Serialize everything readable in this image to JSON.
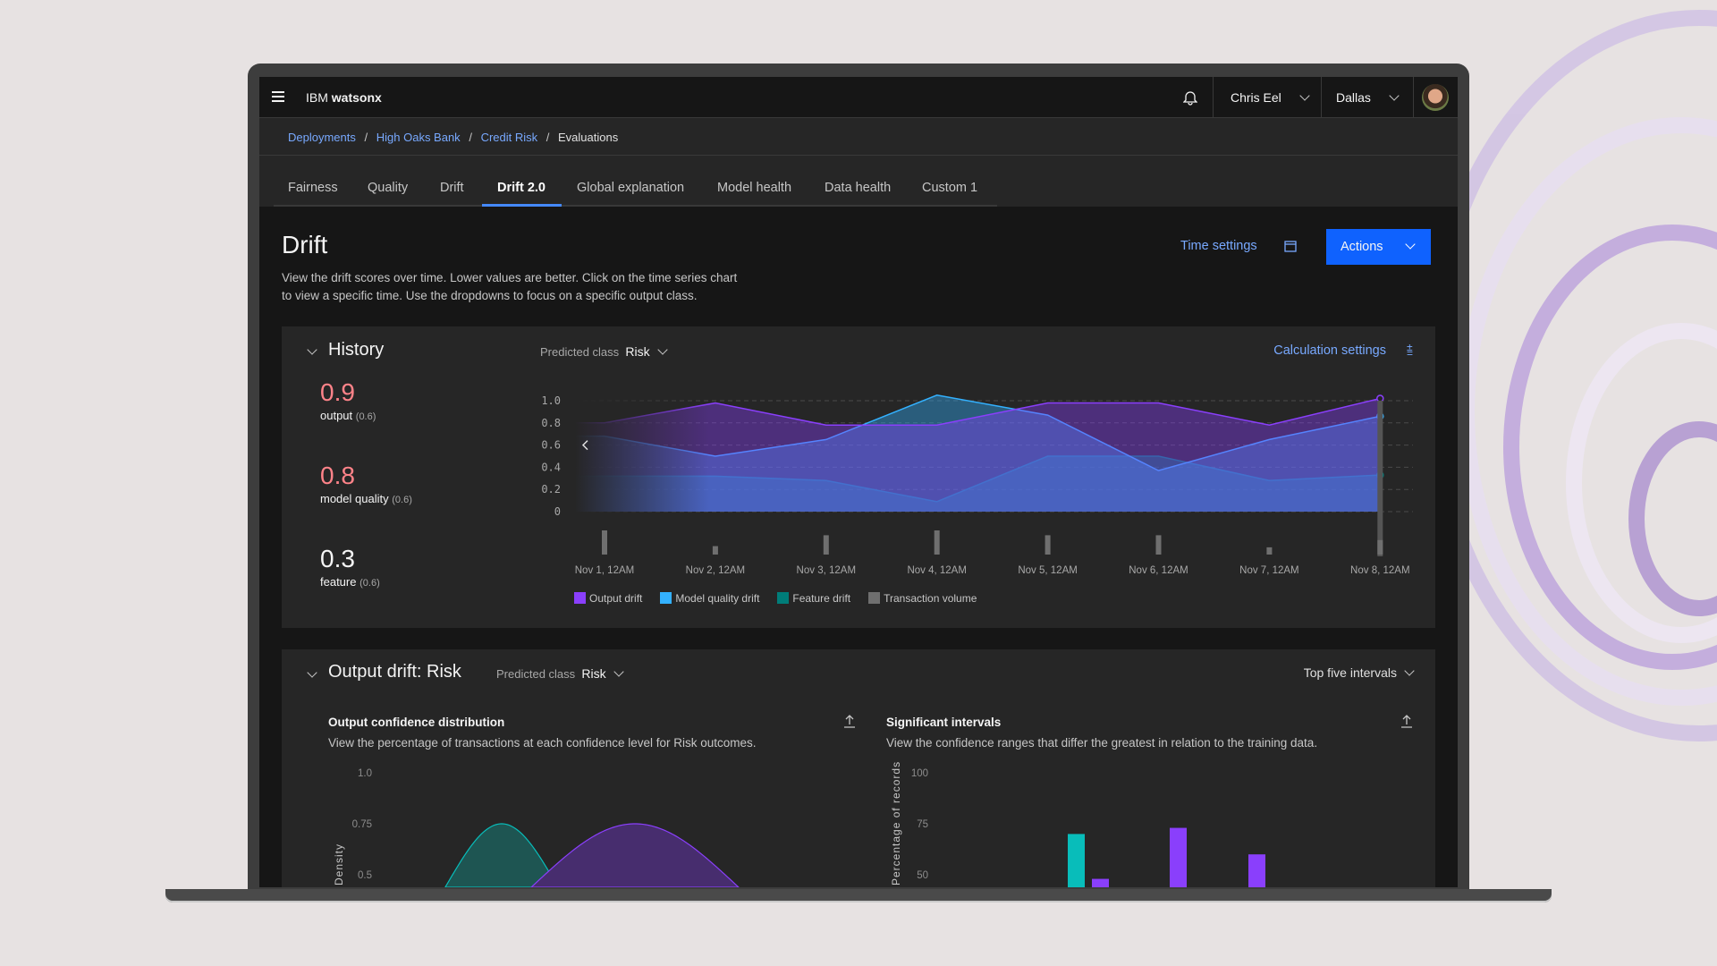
{
  "header": {
    "menu_icon": "hamburger-icon",
    "app_name_prefix": "IBM",
    "app_name": "watsonx",
    "notification_icon": "bell-icon",
    "user": "Chris Eel",
    "region": "Dallas",
    "avatar": "user-avatar"
  },
  "breadcrumb": [
    {
      "label": "Deployments"
    },
    {
      "label": "High Oaks Bank"
    },
    {
      "label": "Credit Risk"
    },
    {
      "label": "Evaluations"
    }
  ],
  "breadcrumb_sep": "/",
  "tabs": [
    {
      "label": "Fairness"
    },
    {
      "label": "Quality"
    },
    {
      "label": "Drift"
    },
    {
      "label": "Drift 2.0",
      "active": true
    },
    {
      "label": "Global explanation"
    },
    {
      "label": "Model health"
    },
    {
      "label": "Data health"
    },
    {
      "label": "Custom 1"
    }
  ],
  "page": {
    "title": "Drift",
    "description_1": "View the drift scores over time. Lower values are better. Click on the time series chart",
    "description_2": "to view a specific time. Use the dropdowns to focus on a specific output class.",
    "time_settings": "Time settings",
    "actions": "Actions",
    "accent": "#0f62fe"
  },
  "history": {
    "title": "History",
    "predicted_class_label": "Predicted class",
    "predicted_class": "Risk",
    "calc_settings": "Calculation settings",
    "scores": [
      {
        "value": "0.9",
        "label": "output",
        "threshold": "(0.6)",
        "color": "#ff8389"
      },
      {
        "value": "0.8",
        "label": "model quality",
        "threshold": "(0.6)",
        "color": "#ff8389"
      },
      {
        "value": "0.3",
        "label": "feature",
        "threshold": "(0.6)",
        "color": "#f4f4f4"
      }
    ]
  },
  "chart_data": [
    {
      "type": "area",
      "x": [
        "Nov 1, 12AM",
        "Nov 2, 12AM",
        "Nov 3, 12AM",
        "Nov 4, 12AM",
        "Nov 5, 12AM",
        "Nov 6, 12AM",
        "Nov 7, 12AM",
        "Nov 8, 12AM"
      ],
      "yticks": [
        "1.0",
        "0.8",
        "0.6",
        "0.4",
        "0.2",
        "0"
      ],
      "ylim": [
        0,
        1
      ],
      "grid": true,
      "legend": "bottom",
      "series": [
        {
          "name": "Output drift",
          "color": "#8a3ffc",
          "values": [
            0.8,
            0.98,
            0.78,
            0.78,
            0.98,
            0.98,
            0.78,
            1.02
          ]
        },
        {
          "name": "Model quality drift",
          "color": "#33b1ff",
          "values": [
            0.68,
            0.5,
            0.65,
            1.05,
            0.87,
            0.37,
            0.65,
            0.86
          ]
        },
        {
          "name": "Feature drift",
          "color": "#007d79",
          "values": [
            0.32,
            0.32,
            0.28,
            0.09,
            0.5,
            0.5,
            0.28,
            0.33
          ]
        },
        {
          "name": "Transaction volume",
          "color": "#6f6f6f",
          "values": [
            1.0,
            0.35,
            0.8,
            1.0,
            0.8,
            0.8,
            0.3,
            0.6
          ]
        }
      ]
    },
    {
      "type": "area",
      "title": "Output confidence distribution",
      "ylabel": "Density",
      "yticks": [
        "1.0",
        "0.75",
        "0.5"
      ],
      "ylim": [
        0,
        1
      ],
      "series": [
        {
          "color": "#08bdba",
          "peak": 0.75
        },
        {
          "color": "#8a3ffc",
          "peak": 0.75
        }
      ]
    },
    {
      "type": "bar",
      "title": "Significant intervals",
      "ylabel": "Percentage of records",
      "yticks": [
        "100",
        "75",
        "50"
      ],
      "ylim": [
        0,
        100
      ],
      "series": [
        {
          "color": "#08bdba",
          "values": [
            70
          ]
        },
        {
          "color": "#8a3ffc",
          "values": [
            48,
            73,
            60
          ]
        }
      ]
    }
  ],
  "output_drift": {
    "title": "Output drift: Risk",
    "predicted_class_label": "Predicted class",
    "predicted_class": "Risk",
    "intervals": "Top five intervals",
    "left": {
      "title": "Output confidence distribution",
      "desc": "View the percentage of transactions at each confidence level for Risk outcomes."
    },
    "right": {
      "title": "Significant intervals",
      "desc": "View the confidence ranges that differ the greatest in relation to the training data."
    }
  }
}
